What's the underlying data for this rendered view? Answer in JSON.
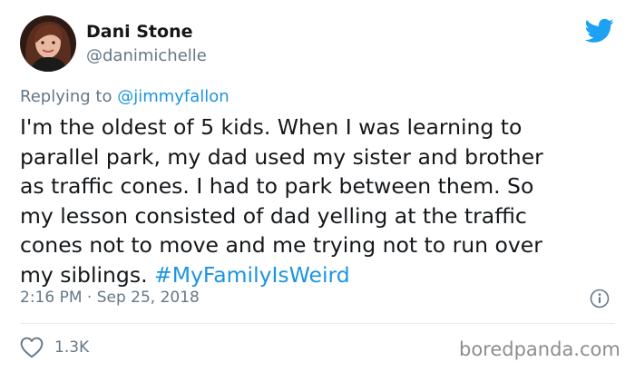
{
  "tweet": {
    "display_name": "Dani Stone",
    "handle": "@danimichelle",
    "reply_prefix": "Replying to ",
    "reply_to": "@jimmyfallon",
    "text": "I'm the oldest of 5 kids. When I was learning to\nparallel park, my dad used my sister and brother\nas traffic cones. I had to park between them. So\nmy lesson consisted of dad yelling at the traffic\ncones not to move and me trying not to run over\nmy siblings.  ",
    "hashtag": "#MyFamilyIsWeird",
    "timestamp": "2:16 PM · Sep 25, 2018",
    "like_count": "1.3K"
  },
  "icons": {
    "brand": "twitter-bird-icon",
    "info": "info-icon",
    "like": "heart-icon"
  },
  "colors": {
    "brand": "#1da1f2",
    "link": "#1b95e0",
    "muted": "#657786",
    "text": "#14171a"
  },
  "watermark": "boredpanda.com"
}
